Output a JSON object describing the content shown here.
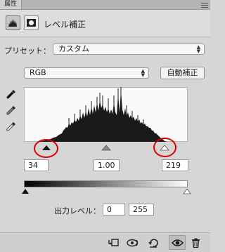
{
  "panel": {
    "tab_label": "属性"
  },
  "header": {
    "title": "レベル補正"
  },
  "preset": {
    "label": "プリセット：",
    "value": "カスタム"
  },
  "channel": {
    "value": "RGB"
  },
  "buttons": {
    "auto_label": "自動補正"
  },
  "input_levels": {
    "black": "34",
    "gamma": "1.00",
    "white": "219"
  },
  "output_levels": {
    "label": "出力レベル：",
    "black": "0",
    "white": "255"
  },
  "colors": {
    "highlight_circle": "#e00000",
    "panel_bg": "#d6d6d6"
  },
  "icons": [
    "panel-menu-icon",
    "levels-adjustment-icon",
    "layer-mask-icon",
    "black-eyedropper-icon",
    "gray-eyedropper-icon",
    "white-eyedropper-icon",
    "clip-to-layer-icon",
    "view-previous-state-icon",
    "reset-icon",
    "visibility-eye-icon",
    "trash-icon"
  ]
}
